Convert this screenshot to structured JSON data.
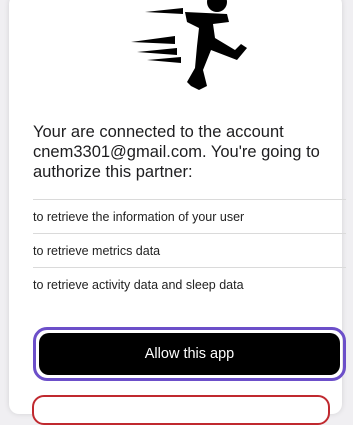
{
  "logo": {
    "icon": "running-figure-icon"
  },
  "message": "Your are connected to the account cnem3301@gmail.com. You're going to authorize this partner:",
  "permissions": [
    "to retrieve the information of your user",
    "to retrieve metrics data",
    "to retrieve activity data and sleep data"
  ],
  "actions": {
    "allow_label": "Allow this app",
    "focus_color": "#6c4fc9",
    "deny_border_color": "#c0292f"
  }
}
